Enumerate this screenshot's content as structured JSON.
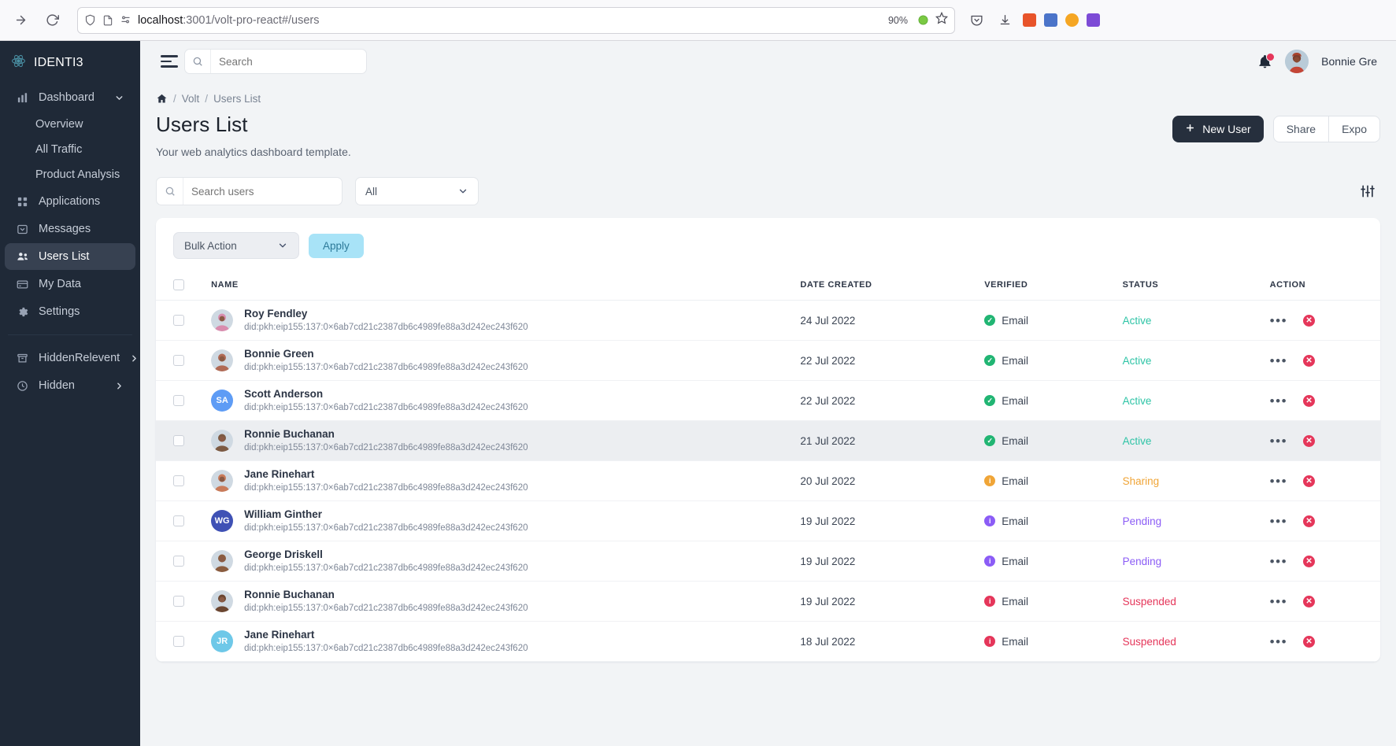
{
  "browser": {
    "url_prefix": "localhost",
    "url_rest": ":3001/volt-pro-react#/users",
    "zoom": "90%"
  },
  "sidebar": {
    "brand": "IDENTI3",
    "items": [
      {
        "label": "Dashboard",
        "icon": "bar-chart-icon",
        "expandable": true,
        "state": "expanded"
      },
      {
        "label": "Overview",
        "icon": "",
        "sub": true
      },
      {
        "label": "All Traffic",
        "icon": "",
        "sub": true
      },
      {
        "label": "Product Analysis",
        "icon": "",
        "sub": true
      },
      {
        "label": "Applications",
        "icon": "grid-icon"
      },
      {
        "label": "Messages",
        "icon": "inbox-icon"
      },
      {
        "label": "Users List",
        "icon": "users-icon",
        "active": true
      },
      {
        "label": "My Data",
        "icon": "card-icon"
      },
      {
        "label": "Settings",
        "icon": "gear-icon"
      }
    ],
    "bottom_items": [
      {
        "label": "HiddenRelevent",
        "icon": "archive-icon",
        "expandable": true
      },
      {
        "label": "Hidden",
        "icon": "clock-icon",
        "expandable": true
      }
    ]
  },
  "topbar": {
    "search_placeholder": "Search",
    "search_value": "",
    "profile_name": "Bonnie Gre",
    "notification_badge": true
  },
  "breadcrumb": {
    "home": "home-icon",
    "items": [
      "Volt",
      "Users List"
    ],
    "separator": "/"
  },
  "page": {
    "title": "Users List",
    "subtitle": "Your web analytics dashboard template."
  },
  "header_actions": {
    "new_user": "New User",
    "share": "Share",
    "export": "Expo"
  },
  "filters": {
    "search_placeholder": "Search users",
    "search_value": "",
    "dropdown_value": "All",
    "filter_icon": "sliders-icon"
  },
  "toolbar": {
    "bulk_action_value": "Bulk Action",
    "apply_label": "Apply"
  },
  "table": {
    "columns": [
      "",
      "NAME",
      "DATE CREATED",
      "VERIFIED",
      "STATUS",
      "ACTION"
    ],
    "verified_label": "Email",
    "rows": [
      {
        "name": "Roy Fendley",
        "did": "did:pkh:eip155:137:0×6ab7cd21c2387db6c4989fe88a3d242ec243f620",
        "date": "24 Jul 2022",
        "verified": "Email",
        "verified_type": "check",
        "status": "Active",
        "avatar": "photo",
        "avatar_color": "#d98cae",
        "highlight": false
      },
      {
        "name": "Bonnie Green",
        "did": "did:pkh:eip155:137:0×6ab7cd21c2387db6c4989fe88a3d242ec243f620",
        "date": "22 Jul 2022",
        "verified": "Email",
        "verified_type": "check",
        "status": "Active",
        "avatar": "photo",
        "avatar_color": "#b06a55",
        "highlight": false
      },
      {
        "name": "Scott Anderson",
        "did": "did:pkh:eip155:137:0×6ab7cd21c2387db6c4989fe88a3d242ec243f620",
        "date": "22 Jul 2022",
        "verified": "Email",
        "verified_type": "check",
        "status": "Active",
        "avatar": "initials",
        "initials": "SA",
        "avatar_color": "#5e9cf5",
        "highlight": false
      },
      {
        "name": "Ronnie Buchanan",
        "did": "did:pkh:eip155:137:0×6ab7cd21c2387db6c4989fe88a3d242ec243f620",
        "date": "21 Jul 2022",
        "verified": "Email",
        "verified_type": "check",
        "status": "Active",
        "avatar": "photo",
        "avatar_color": "#7c5a43",
        "highlight": true
      },
      {
        "name": "Jane Rinehart",
        "did": "did:pkh:eip155:137:0×6ab7cd21c2387db6c4989fe88a3d242ec243f620",
        "date": "20 Jul 2022",
        "verified": "Email",
        "verified_type": "info",
        "status": "Sharing",
        "avatar": "photo",
        "avatar_color": "#c97b5a",
        "highlight": false
      },
      {
        "name": "William Ginther",
        "did": "did:pkh:eip155:137:0×6ab7cd21c2387db6c4989fe88a3d242ec243f620",
        "date": "19 Jul 2022",
        "verified": "Email",
        "verified_type": "info",
        "status": "Pending",
        "avatar": "initials",
        "initials": "WG",
        "avatar_color": "#3f51b5",
        "highlight": false
      },
      {
        "name": "George Driskell",
        "did": "did:pkh:eip155:137:0×6ab7cd21c2387db6c4989fe88a3d242ec243f620",
        "date": "19 Jul 2022",
        "verified": "Email",
        "verified_type": "info",
        "status": "Pending",
        "avatar": "photo",
        "avatar_color": "#8a5c3f",
        "highlight": false
      },
      {
        "name": "Ronnie Buchanan",
        "did": "did:pkh:eip155:137:0×6ab7cd21c2387db6c4989fe88a3d242ec243f620",
        "date": "19 Jul 2022",
        "verified": "Email",
        "verified_type": "alert",
        "status": "Suspended",
        "avatar": "photo",
        "avatar_color": "#6b4631",
        "highlight": false
      },
      {
        "name": "Jane Rinehart",
        "did": "did:pkh:eip155:137:0×6ab7cd21c2387db6c4989fe88a3d242ec243f620",
        "date": "18 Jul 2022",
        "verified": "Email",
        "verified_type": "alert",
        "status": "Suspended",
        "avatar": "initials",
        "initials": "JR",
        "avatar_color": "#6ec8e8",
        "highlight": false
      }
    ]
  },
  "colors": {
    "status_active": "#2ec4a6",
    "status_sharing": "#f0a537",
    "status_pending": "#8b5cf6",
    "status_suspended": "#e5365a",
    "verified_check": "#21b573",
    "verified_info": "#f0a537",
    "verified_purple": "#8b5cf6",
    "verified_alert": "#e5365a",
    "accent_dark": "#262f3d",
    "apply_bg": "#a8e3f7"
  }
}
